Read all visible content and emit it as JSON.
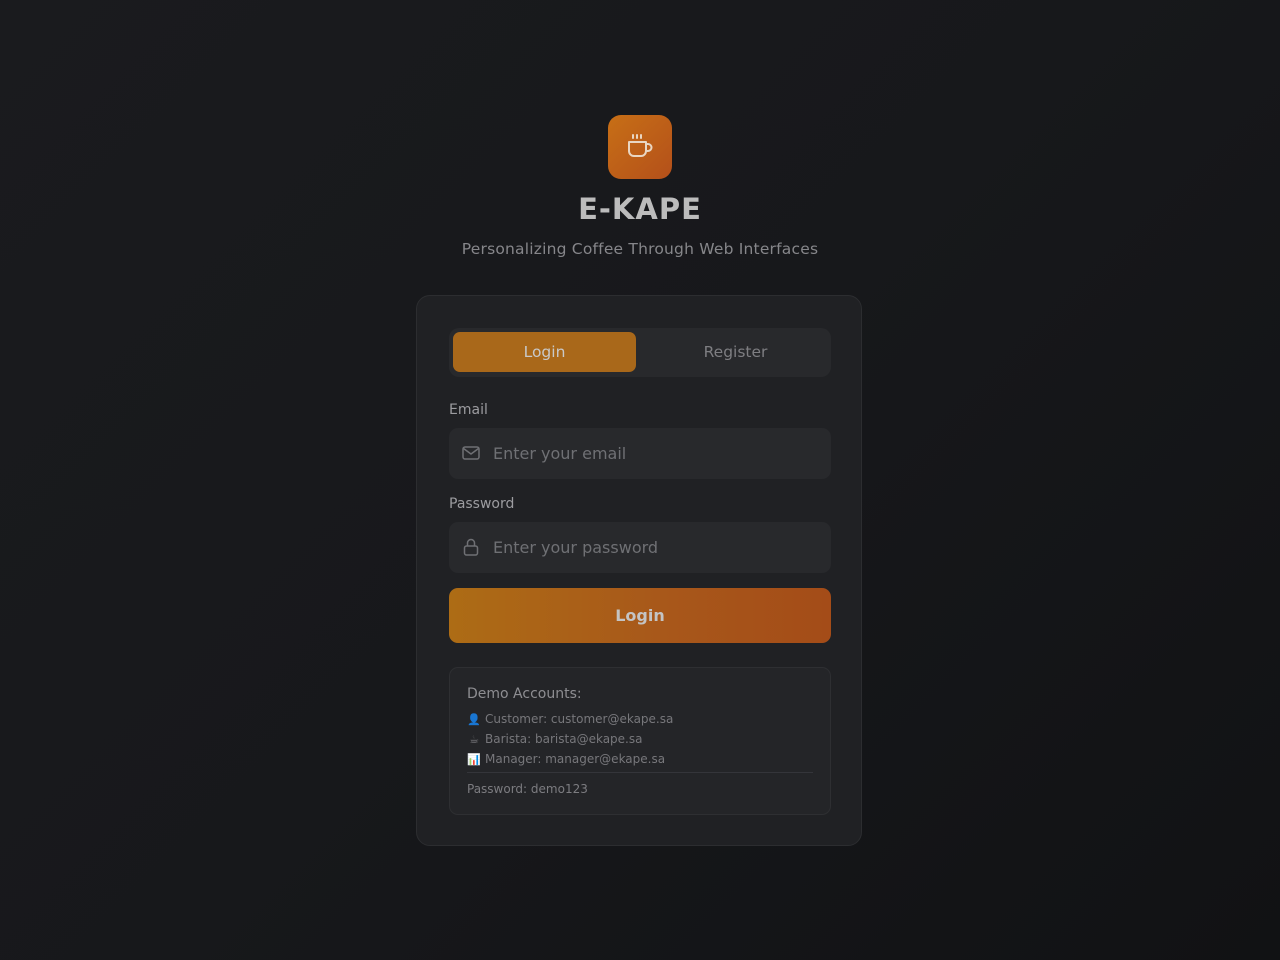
{
  "brand": {
    "name": "E-KAPE",
    "tagline": "Personalizing Coffee Through Web Interfaces",
    "logo_icon": "coffee-cup-icon",
    "accent_color": "#c06a18"
  },
  "auth_tabs": {
    "login_label": "Login",
    "register_label": "Register",
    "active": "Login"
  },
  "form": {
    "email": {
      "label": "Email",
      "placeholder": "Enter your email",
      "value": "",
      "icon": "mail-icon"
    },
    "password": {
      "label": "Password",
      "placeholder": "Enter your password",
      "value": "",
      "icon": "lock-icon"
    },
    "submit_label": "Login"
  },
  "demo_accounts": {
    "title": "Demo Accounts:",
    "accounts": [
      {
        "emoji": "👤",
        "text": "Customer: customer@ekape.sa"
      },
      {
        "emoji": "☕",
        "text": "Barista: barista@ekape.sa"
      },
      {
        "emoji": "📊",
        "text": "Manager: manager@ekape.sa"
      }
    ],
    "password_note": "Password: demo123"
  }
}
